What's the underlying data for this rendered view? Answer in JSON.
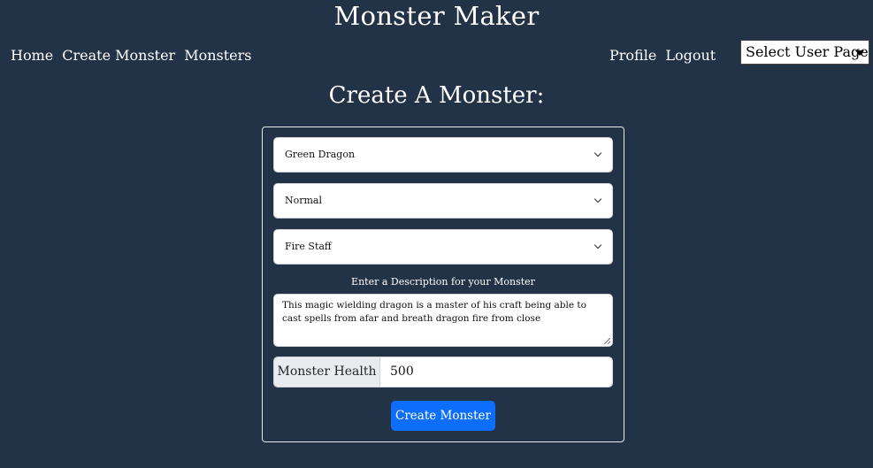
{
  "app": {
    "title": "Monster Maker"
  },
  "nav": {
    "left": [
      "Home",
      "Create Monster",
      "Monsters"
    ],
    "right": [
      "Profile",
      "Logout"
    ],
    "user_select": "Select User Page"
  },
  "page": {
    "heading": "Create A Monster:"
  },
  "form": {
    "monster_type": "Green Dragon",
    "difficulty": "Normal",
    "weapon": "Fire Staff",
    "description_label": "Enter a Description for your Monster",
    "description_value": "This magic wielding dragon is a master of his craft being able to cast spells from afar and breath dragon fire from close",
    "health_label": "Monster Health",
    "health_value": "500",
    "submit_label": "Create Monster"
  },
  "icons": {
    "select_caret": "caret-down-icon",
    "select_chevron": "chevron-down-icon",
    "textarea_grip": "resize-grip-icon"
  },
  "colors": {
    "background": "#233347",
    "primary_button": "#0d6efd",
    "addon_bg": "#e9ecef"
  }
}
